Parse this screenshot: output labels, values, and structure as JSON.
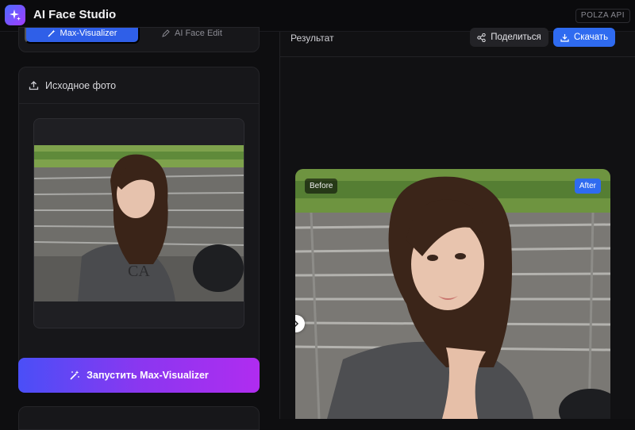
{
  "app": {
    "title": "AI Face Studio",
    "api_badge": "POLZA API"
  },
  "colors": {
    "accent": "#2f6bf0",
    "gradient_start": "#4a4ff7",
    "gradient_end": "#b02cf0",
    "panel": "#17171a",
    "background": "#0e0e10"
  },
  "modes": {
    "active_label": "Max-Visualizer",
    "active_icon": "wand-icon",
    "other_label": "AI Face Edit",
    "other_icon": "pen-icon"
  },
  "source": {
    "title": "Исходное фото",
    "icon": "upload-icon"
  },
  "run": {
    "label": "Запустить Max-Visualizer",
    "icon": "magic-wand-icon"
  },
  "result": {
    "title": "Результат",
    "share_label": "Поделиться",
    "download_label": "Скачать",
    "before_label": "Before",
    "after_label": "After"
  }
}
